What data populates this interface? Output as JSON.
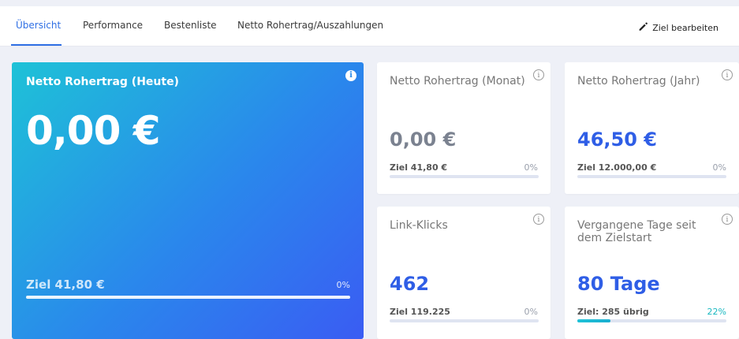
{
  "tabs": [
    {
      "label": "Übersicht",
      "active": true
    },
    {
      "label": "Performance",
      "active": false
    },
    {
      "label": "Bestenliste",
      "active": false
    },
    {
      "label": "Netto Rohertrag/Auszahlungen",
      "active": false
    }
  ],
  "header": {
    "edit_goal_label": "Ziel bearbeiten",
    "edit_icon": "pencil-icon"
  },
  "hero": {
    "title": "Netto Rohertrag (Heute)",
    "value": "0,00 €",
    "goal": "Ziel 41,80 €",
    "percent": "0%",
    "progress": 0
  },
  "cards": [
    {
      "title": "Netto Rohertrag (Monat)",
      "value": "0,00 €",
      "goal": "Ziel 41,80 €",
      "percent": "0%",
      "progress": 0
    },
    {
      "title": "Netto Rohertrag (Jahr)",
      "value": "46,50 €",
      "goal": "Ziel 12.000,00 €",
      "percent": "0%",
      "progress": 0
    },
    {
      "title": "Link-Klicks",
      "value": "462",
      "goal": "Ziel 119.225",
      "percent": "0%",
      "progress": 0
    },
    {
      "title": "Vergangene Tage seit dem Zielstart",
      "value": "80 Tage",
      "goal": "Ziel: 285 übrig",
      "percent": "22%",
      "progress": 0.22
    }
  ],
  "colors": {
    "accent": "#2f6fe4",
    "value_blue": "#2f5ee6",
    "value_grey": "#7b8290",
    "progress_teal": "#18b8c0"
  },
  "info_icon_glyph": "i"
}
